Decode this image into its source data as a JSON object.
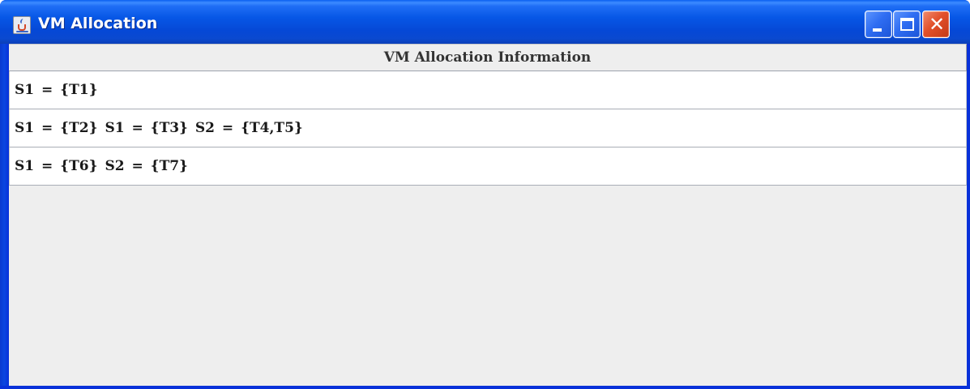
{
  "window": {
    "title": "VM Allocation"
  },
  "titlebar_icons": {
    "app_icon": "java-coffee-cup-icon",
    "minimize_icon": "minimize-icon",
    "maximize_icon": "maximize-icon",
    "close_icon": "close-icon",
    "close_glyph": "✕"
  },
  "table": {
    "header": "VM Allocation Information",
    "rows": [
      "S1 = {T1}",
      "S1 = {T2} S1 = {T3} S2 = {T4,T5}",
      "S1 = {T6} S2 = {T7}"
    ]
  },
  "colors": {
    "titlebar": "#0757e6",
    "frame": "#0831d9",
    "close_button": "#e2502a",
    "client_background": "#eeeeee"
  }
}
